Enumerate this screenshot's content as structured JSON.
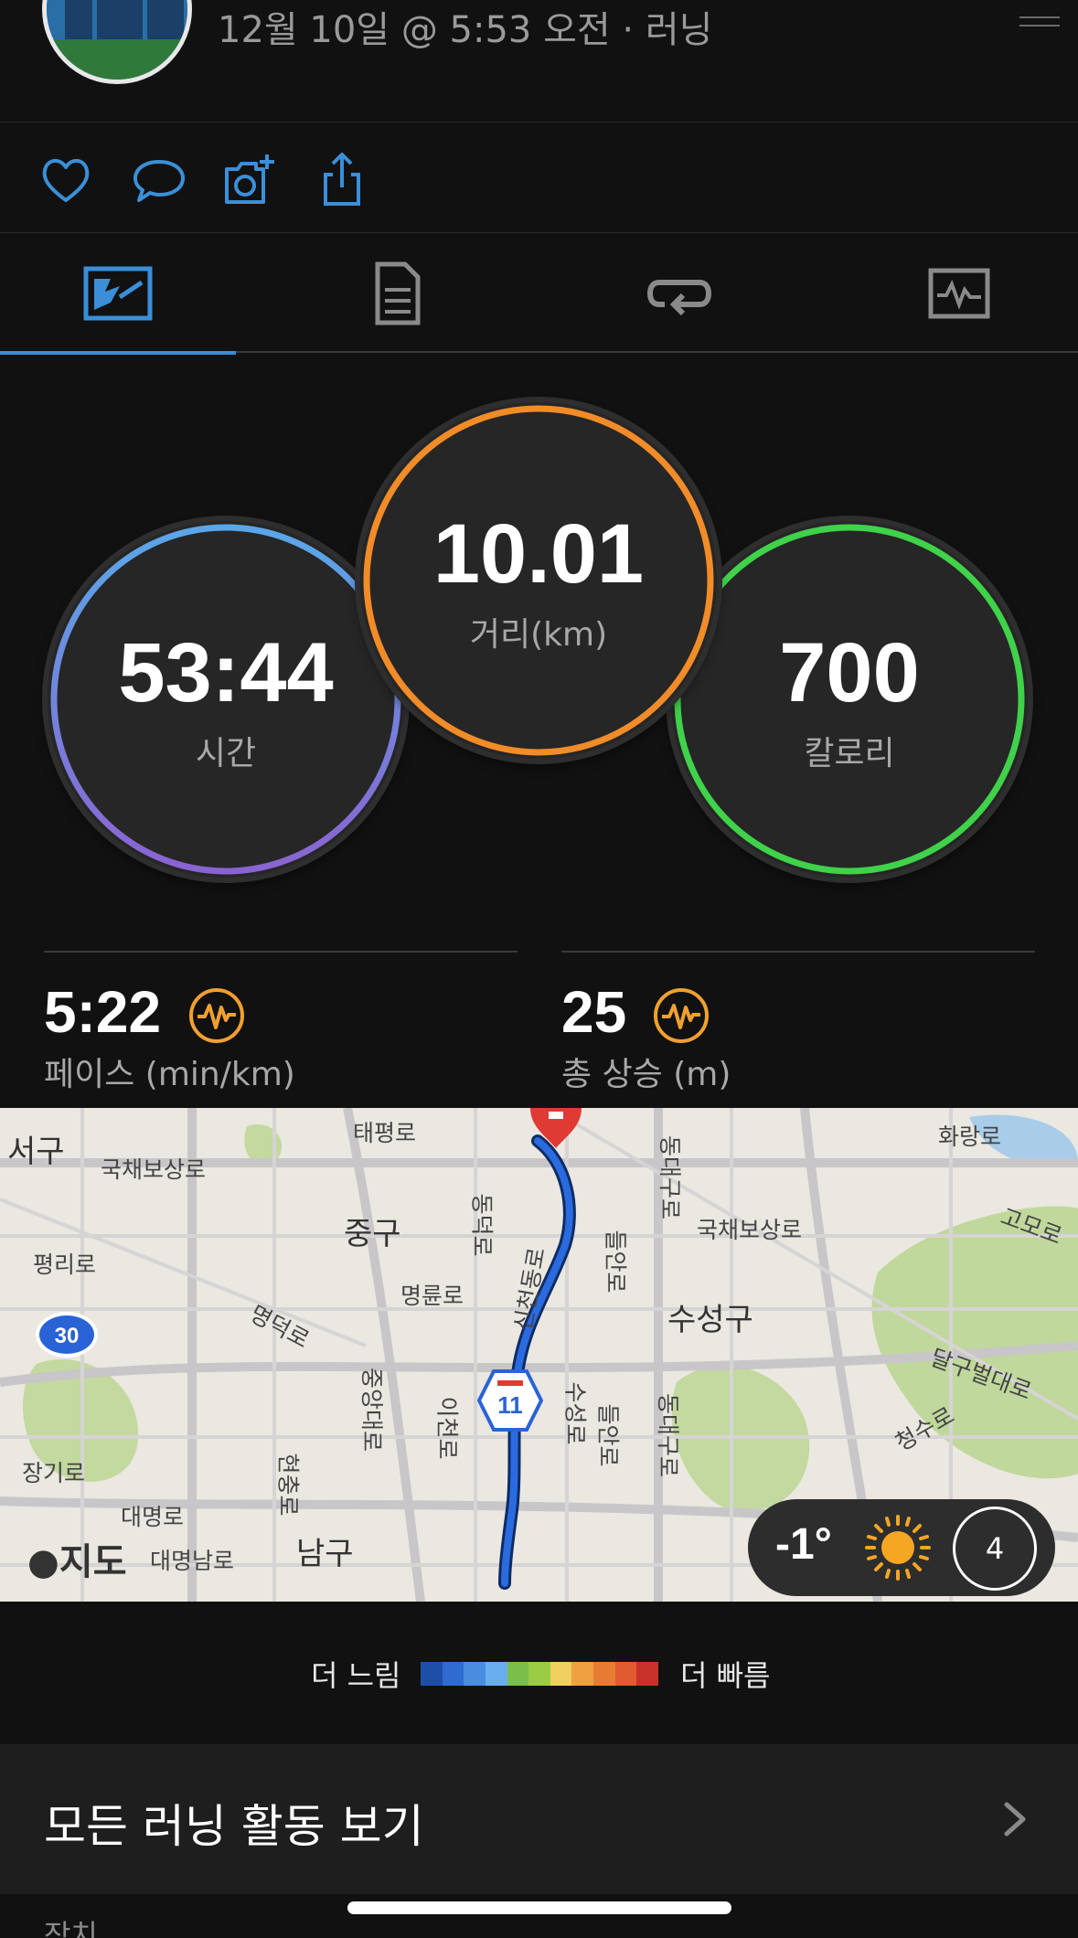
{
  "header": {
    "subtitle": "12월 10일 @ 5:53 오전 · 러닝"
  },
  "actions": [
    "heart-icon",
    "comment-icon",
    "add-photo-icon",
    "share-icon"
  ],
  "tabs": [
    {
      "icon": "map-overview-icon",
      "active": true
    },
    {
      "icon": "details-document-icon",
      "active": false
    },
    {
      "icon": "laps-icon",
      "active": false
    },
    {
      "icon": "chart-icon",
      "active": false
    }
  ],
  "stats": {
    "time": {
      "value": "53:44",
      "label": "시간",
      "color_top": "#5aa7e8",
      "color_bottom": "#8a63d2"
    },
    "distance": {
      "value": "10.01",
      "label": "거리(km)",
      "color": "#f28c28"
    },
    "calories": {
      "value": "700",
      "label": "칼로리",
      "color": "#3fd24a"
    }
  },
  "metrics": {
    "pace": {
      "value": "5:22",
      "label": "페이스 (min/km)"
    },
    "elevation": {
      "value": "25",
      "label": "총 상승 (m)"
    }
  },
  "map": {
    "labels": {
      "seogu": "서구",
      "gukchae1": "국채보상로",
      "taepyeong": "태평로",
      "junggu": "중구",
      "pyeongri": "평리로",
      "myeongdeok": "명덕로",
      "myeongnyun": "명륜로",
      "jungang": "중앙대로",
      "icheon": "이천로",
      "hyeonchung": "현충로",
      "janggi": "장기로",
      "daemyeong": "대명로",
      "daemyeongnam": "대명남로",
      "namgu": "남구",
      "suseonggu": "수성구",
      "gukchae2": "국채보상로",
      "dongdae1": "동대구로",
      "dongdae2": "동대구로",
      "hwarang": "화랑로",
      "gomo": "고모로",
      "dalgubeol": "달구벌대로",
      "cheongsu": "청수로",
      "sinchon": "신천동로",
      "dongdeok": "동덕로",
      "dulayo1": "들안로",
      "dulayo2": "들안로",
      "suseongro": "수성로",
      "route30": "30",
      "route11": "11",
      "apple_maps": "지도"
    },
    "weather": {
      "temp": "-1°",
      "icon": "sun-icon",
      "wind": "4"
    }
  },
  "legend": {
    "slow": "더 느림",
    "fast": "더 빠름",
    "colors": [
      "#1e4fa8",
      "#2f6bd0",
      "#4a8de0",
      "#6aaef0",
      "#7bbf4a",
      "#9bcc45",
      "#f0d060",
      "#f0a040",
      "#e87b33",
      "#e05b30",
      "#c8322a"
    ]
  },
  "all_runs": {
    "label": "모든 러닝 활동 보기"
  },
  "device_section": {
    "label": "장치"
  }
}
